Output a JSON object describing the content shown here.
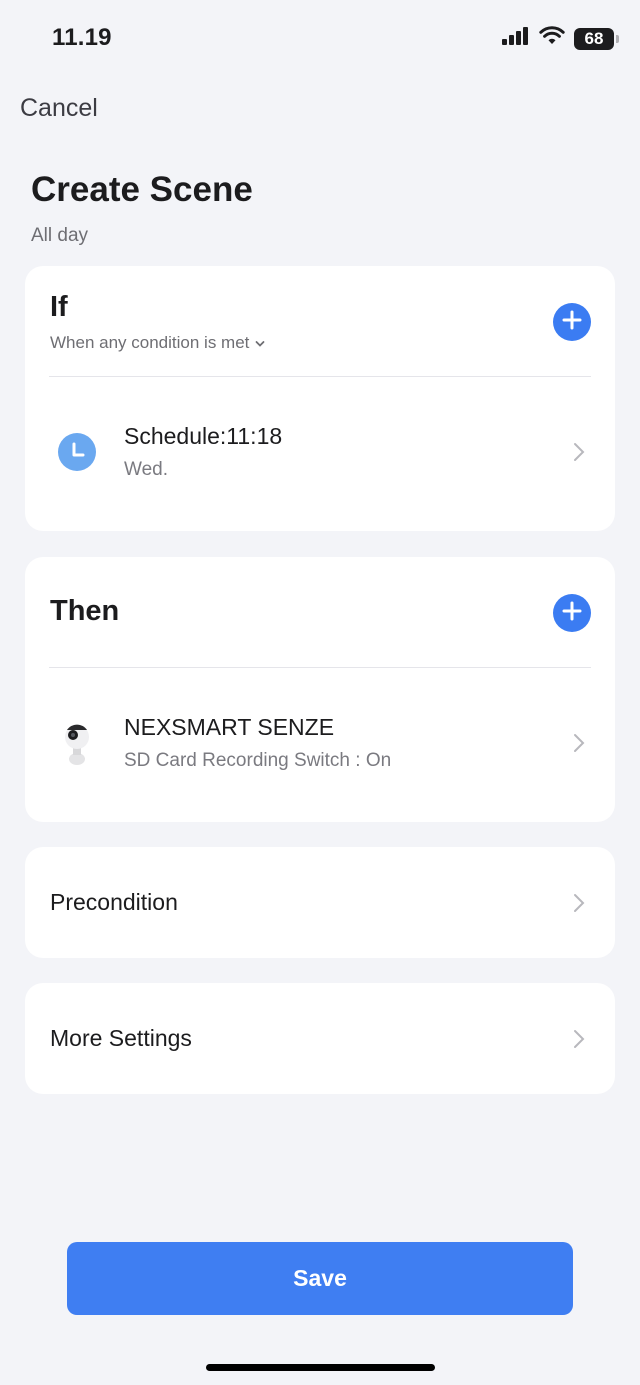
{
  "status_bar": {
    "time": "11.19",
    "battery": "68"
  },
  "header": {
    "cancel_label": "Cancel",
    "title": "Create Scene",
    "subtitle": "All day"
  },
  "if_section": {
    "title": "If",
    "condition_mode": "When any condition is met",
    "items": [
      {
        "title": "Schedule:11:18",
        "subtitle": "Wed.",
        "icon": "clock-icon"
      }
    ]
  },
  "then_section": {
    "title": "Then",
    "items": [
      {
        "title": "NEXSMART SENZE",
        "subtitle": "SD Card Recording Switch : On",
        "icon": "camera-icon"
      }
    ]
  },
  "precondition": {
    "label": "Precondition"
  },
  "more_settings": {
    "label": "More Settings"
  },
  "save_label": "Save",
  "colors": {
    "accent": "#3b7cf2",
    "clock_icon": "#6aa8f0",
    "background": "#f3f4f8",
    "card": "#ffffff"
  }
}
